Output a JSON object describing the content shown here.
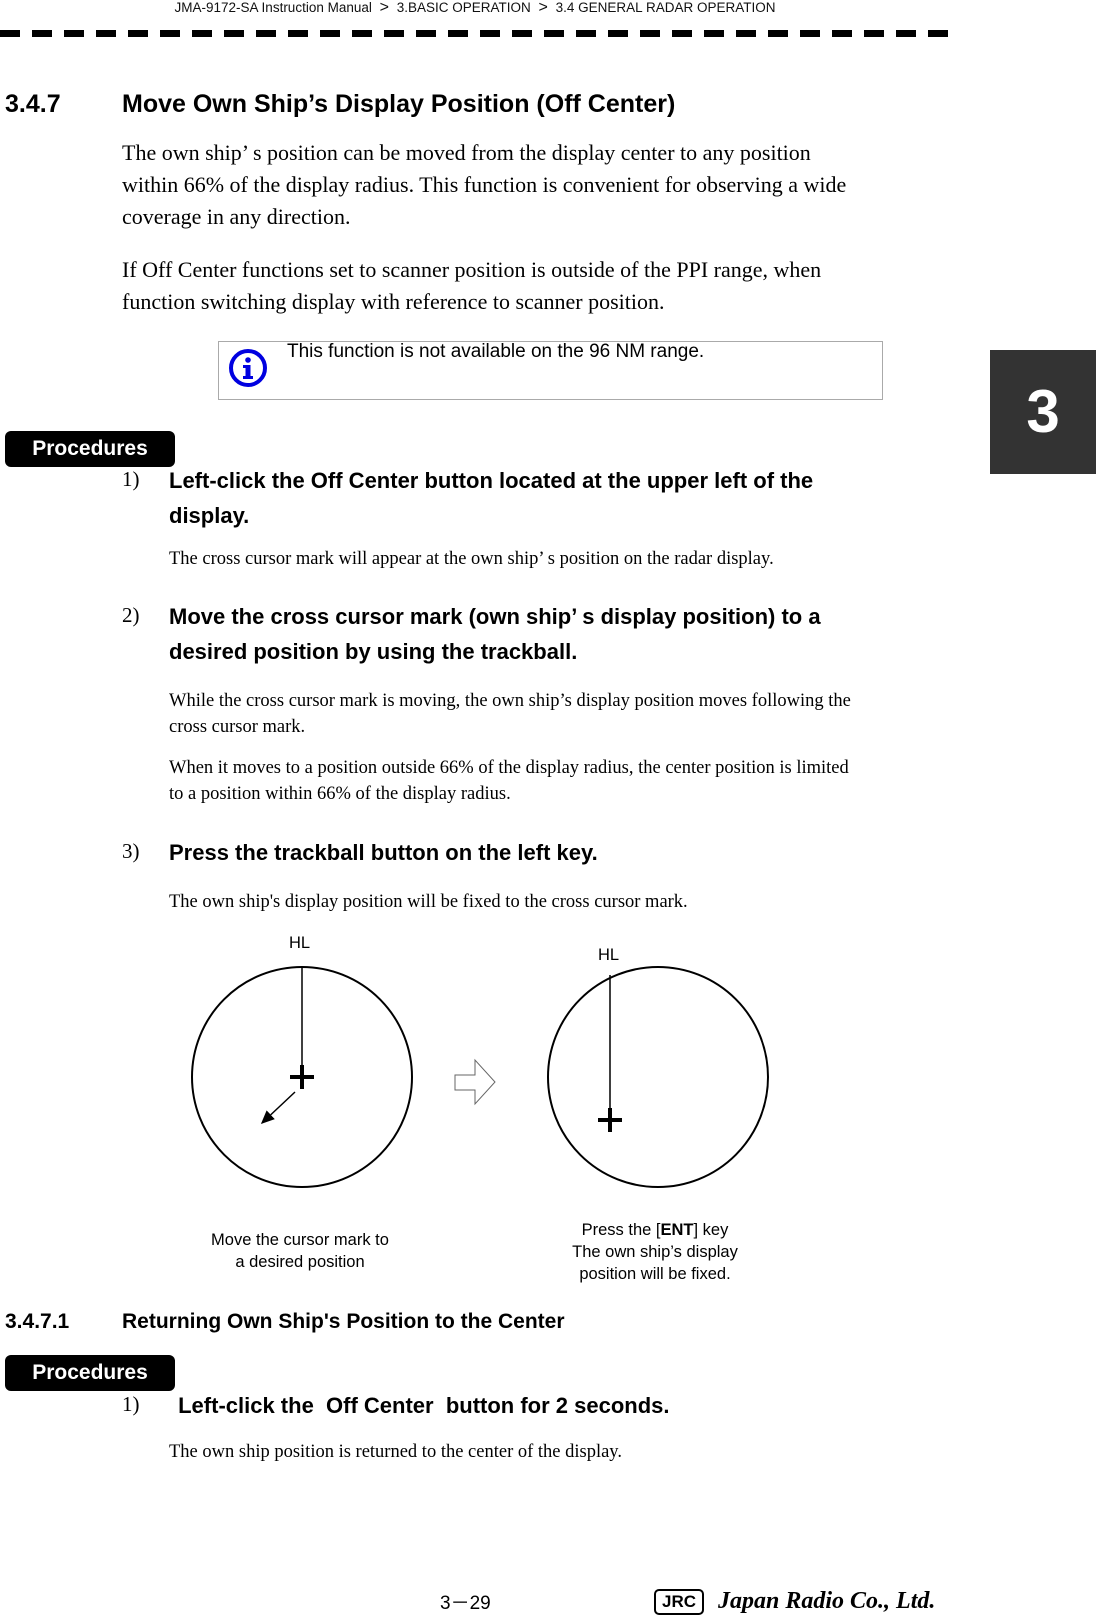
{
  "header": {
    "breadcrumb": [
      "JMA-9172-SA Instruction Manual",
      "3.BASIC OPERATION",
      "3.4  GENERAL RADAR OPERATION"
    ],
    "separator": ">"
  },
  "chapter_tab": "3",
  "section": {
    "number": "3.4.7",
    "title": "Move Own Ship’s Display Position (Off Center)",
    "paragraphs": [
      [
        "The own ship’ s position can be moved from the display center to any position",
        "within 66% of the display radius. This function is convenient for observing a wide",
        "coverage in any direction."
      ],
      [
        "If Off Center functions set to scanner position is outside of the PPI range, when",
        "function switching display with reference to scanner position."
      ]
    ],
    "note": {
      "icon": "info-icon",
      "text": "This function is not available on the 96 NM range."
    },
    "procedures_label": "Procedures",
    "steps": [
      {
        "num": "1)",
        "title": [
          "Left-click the  Off Center  button located at the upper left of the",
          "display."
        ],
        "desc": [
          [
            "The cross cursor mark will appear at the own ship’ s position on the radar display."
          ]
        ]
      },
      {
        "num": "2)",
        "title": [
          "Move the cross cursor mark (own ship’ s display position) to a",
          "desired position by using the trackball."
        ],
        "desc": [
          [
            "While the cross cursor mark is moving, the own ship’s display position moves following the",
            "cross cursor mark."
          ],
          [
            "When it moves to a position outside 66% of the display radius, the center position is limited",
            "to a position within 66% of the display radius."
          ]
        ]
      },
      {
        "num": "3)",
        "title": [
          "Press the trackball button on the left key."
        ],
        "desc": [
          [
            "The own ship's display position will be fixed to the cross cursor mark."
          ]
        ]
      }
    ],
    "diagram": {
      "left": {
        "label": "HL",
        "caption": [
          "Move the cursor mark to",
          "a desired position"
        ]
      },
      "right": {
        "label": "HL",
        "caption_prefix": "Press the [",
        "caption_key": "ENT",
        "caption_suffix": "] key",
        "caption": [
          "The own ship’s display",
          "position will be fixed."
        ]
      }
    }
  },
  "subsection": {
    "number": "3.4.7.1",
    "title": "Returning Own Ship's Position to the Center",
    "procedures_label": "Procedures",
    "steps": [
      {
        "num": "1)",
        "title": " Left-click the  Off Center  button for 2 seconds.",
        "desc": "The own ship position is returned to the center of the display."
      }
    ]
  },
  "footer": {
    "page": "3－29",
    "logo_mark": "JRC",
    "company": "Japan Radio Co., Ltd."
  }
}
